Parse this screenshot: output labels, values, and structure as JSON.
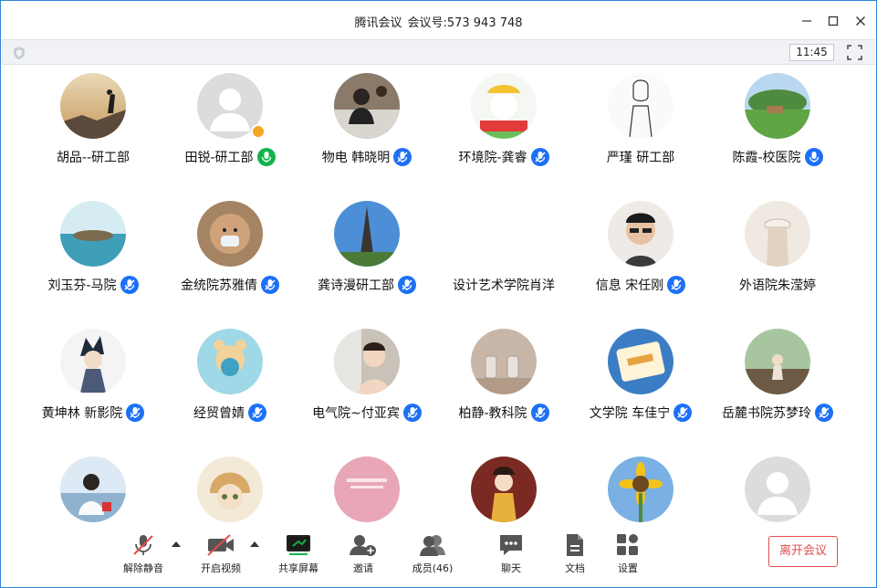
{
  "window": {
    "app_name": "腾讯会议",
    "meeting_id_label": "会议号:",
    "meeting_id": "573 943 748"
  },
  "status": {
    "elapsed_time": "11:45"
  },
  "participants": [
    {
      "name": "胡品--研工部",
      "mic": "none"
    },
    {
      "name": "田锐-研工部",
      "mic": "green"
    },
    {
      "name": "物电 韩晓明",
      "mic": "blue"
    },
    {
      "name": "环境院-龚睿",
      "mic": "blue"
    },
    {
      "name": "严瑾 研工部",
      "mic": "none"
    },
    {
      "name": "陈霞-校医院",
      "mic": "blue"
    },
    {
      "name": "刘玉芬-马院",
      "mic": "blue"
    },
    {
      "name": "金统院苏雅倩",
      "mic": "blue"
    },
    {
      "name": "龚诗漫研工部",
      "mic": "blue"
    },
    {
      "name": "设计艺术学院肖洋",
      "mic": "none"
    },
    {
      "name": "信息 宋任刚",
      "mic": "blue"
    },
    {
      "name": "外语院朱滢婷",
      "mic": "none"
    },
    {
      "name": "黄坤林 新影院",
      "mic": "blue"
    },
    {
      "name": "经贸曾婧",
      "mic": "blue"
    },
    {
      "name": "电气院~付亚宾",
      "mic": "blue"
    },
    {
      "name": "柏静-教科院",
      "mic": "blue"
    },
    {
      "name": "文学院 车佳宁",
      "mic": "blue"
    },
    {
      "name": "岳麓书院苏梦玲",
      "mic": "blue"
    },
    {
      "name": "",
      "mic": "none"
    },
    {
      "name": "",
      "mic": "none"
    },
    {
      "name": "",
      "mic": "none"
    },
    {
      "name": "",
      "mic": "none"
    },
    {
      "name": "",
      "mic": "none"
    },
    {
      "name": "",
      "mic": "none"
    }
  ],
  "toolbar": {
    "unmute": "解除静音",
    "start_video": "开启视频",
    "share_screen": "共享屏幕",
    "invite": "邀请",
    "members": "成员(46)",
    "chat": "聊天",
    "docs": "文档",
    "settings": "设置",
    "leave": "离开会议"
  },
  "colors": {
    "accent_blue": "#1d70f5",
    "mic_green": "#12b34a",
    "leave_red": "#e34d4d",
    "share_green": "#12b34a"
  }
}
